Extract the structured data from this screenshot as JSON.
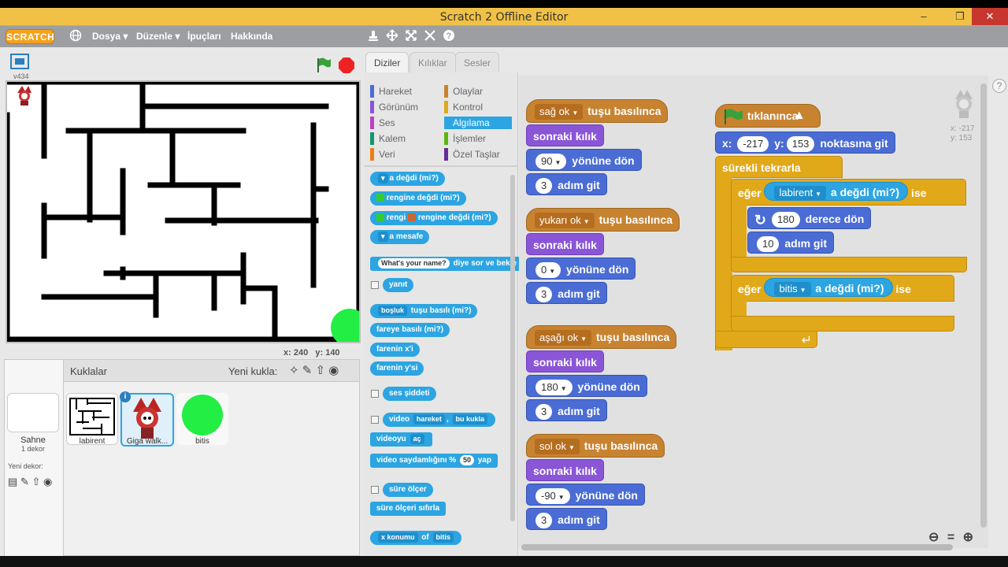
{
  "window": {
    "title": "Scratch 2 Offline Editor"
  },
  "menubar": {
    "logo": "SCRATCH",
    "items": [
      "Dosya ▾",
      "Düzenle ▾",
      "İpuçları",
      "Hakkında"
    ]
  },
  "stage": {
    "version": "v434",
    "coords": "x: 240   y: 140"
  },
  "sprites_panel": {
    "title": "Kuklalar",
    "new_sprite": "Yeni kukla:",
    "stage_label": "Sahne",
    "stage_sub": "1 dekor",
    "new_backdrop": "Yeni dekor:",
    "sprites": [
      "labirent",
      "Giga walk...",
      "bitis"
    ]
  },
  "tabs": [
    "Diziler",
    "Kılıklar",
    "Sesler"
  ],
  "categories": {
    "left": [
      "Hareket",
      "Görünüm",
      "Ses",
      "Kalem",
      "Veri"
    ],
    "right": [
      "Olaylar",
      "Kontrol",
      "Algılama",
      "İşlemler",
      "Özel Taşlar"
    ],
    "colors": {
      "Hareket": "#4a6cd4",
      "Görünüm": "#8a55d7",
      "Ses": "#bb42c3",
      "Kalem": "#0e9a6c",
      "Veri": "#ee7d16",
      "Olaylar": "#c88330",
      "Kontrol": "#e1a91a",
      "Algılama": "#2ca5e2",
      "İşlemler": "#5cb712",
      "Özel Taşlar": "#632d99"
    }
  },
  "palette": {
    "touching": "a değdi (mi?)",
    "touching_color": "rengine değdi (mi?)",
    "color_touch_a": "rengi",
    "color_touch_b": "rengine değdi (mi?)",
    "distance": "a mesafe",
    "ask_default": "What's your name?",
    "ask_tail": "diye sor ve bekle",
    "answer": "yanıt",
    "key_pressed_key": "boşluk",
    "key_pressed": "tuşu basılı (mi?)",
    "mouse_down": "fareye basılı (mi?)",
    "mouse_x": "farenin x'i",
    "mouse_y": "farenin y'si",
    "loudness": "ses şiddeti",
    "video_a": "video",
    "video_dd1": "hareket",
    "video_dd2": "bu kukla",
    "video_on_a": "videoyu",
    "video_on_dd": "aç",
    "video_transp": "video saydamlığını %",
    "video_transp_val": "50",
    "video_transp_tail": "yap",
    "timer": "süre ölçer",
    "reset_timer": "süre ölçeri sıfırla",
    "of_dd1": "x konumu",
    "of_mid": "of",
    "of_dd2": "bitis"
  },
  "scripts": {
    "hats": [
      {
        "key": "sağ ok",
        "label": "tuşu basılınca",
        "costume": "sonraki kılık",
        "dir": "90",
        "dir_label": "yönüne dön",
        "steps": "3",
        "steps_label": "adım git"
      },
      {
        "key": "yukarı ok",
        "label": "tuşu basılınca",
        "costume": "sonraki kılık",
        "dir": "0",
        "dir_label": "yönüne dön",
        "steps": "3",
        "steps_label": "adım git"
      },
      {
        "key": "aşağı ok",
        "label": "tuşu basılınca",
        "costume": "sonraki kılık",
        "dir": "180",
        "dir_label": "yönüne dön",
        "steps": "3",
        "steps_label": "adım git"
      },
      {
        "key": "sol ok",
        "label": "tuşu basılınca",
        "costume": "sonraki kılık",
        "dir": "-90",
        "dir_label": "yönüne dön",
        "steps": "3",
        "steps_label": "adım git"
      }
    ],
    "main": {
      "hat": "tıklanınca",
      "goto_x_label": "x:",
      "goto_x": "-217",
      "goto_y_label": "y:",
      "goto_y": "153",
      "goto_tail": "noktasına git",
      "forever": "sürekli tekrarla",
      "if1": "eğer",
      "if1_target": "labirent",
      "if1_cond": "a değdi (mi?)",
      "if1_tail": "ise",
      "turn_val": "180",
      "turn_label": "derece dön",
      "move_val": "10",
      "move_label": "adım git",
      "if2": "eğer",
      "if2_target": "bitis",
      "if2_cond": "a değdi (mi?)",
      "if2_tail": "ise"
    },
    "sprite_info": {
      "x": "x: -217",
      "y": "y: 153"
    }
  }
}
